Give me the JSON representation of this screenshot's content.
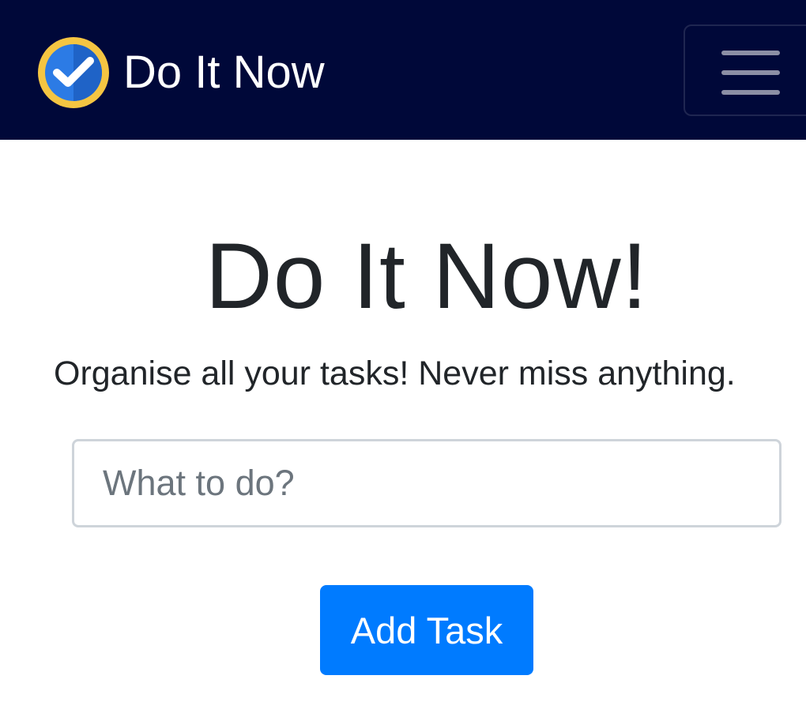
{
  "navbar": {
    "brand_name": "Do It Now",
    "logo_icon": "check-badge-icon",
    "menu_icon": "hamburger-menu-icon"
  },
  "hero": {
    "title": "Do It Now!",
    "tagline": "Organise all your tasks! Never miss anything."
  },
  "task_form": {
    "input_value": "",
    "input_placeholder": "What to do?",
    "add_button_label": "Add Task"
  },
  "colors": {
    "navbar_bg": "#000839",
    "primary": "#007bff",
    "text": "#212529",
    "logo_ring": "#f5c542",
    "logo_blue": "#2c7be5"
  }
}
